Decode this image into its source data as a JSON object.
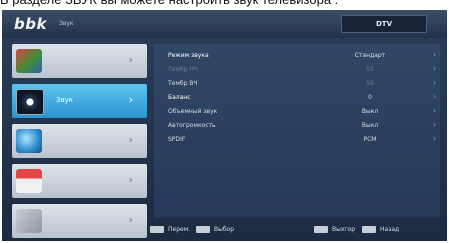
{
  "caption": "В разделе ЗВУК вы можете настроить звук телевизора :",
  "header": {
    "logo": "bbk",
    "section": "Звук",
    "source": "DTV"
  },
  "sidebar": {
    "items": [
      {
        "label": "",
        "icon": "picture-icon",
        "active": false
      },
      {
        "label": "Звук",
        "icon": "speaker-icon",
        "active": true
      },
      {
        "label": "",
        "icon": "globe-icon",
        "active": false
      },
      {
        "label": "",
        "icon": "tv-icon",
        "active": false
      },
      {
        "label": "",
        "icon": "settings-icon",
        "active": false
      }
    ]
  },
  "sound_menu": {
    "rows": [
      {
        "label": "Режим звука",
        "value": "Стандарт"
      },
      {
        "label": "Тембр НЧ",
        "value": "50"
      },
      {
        "label": "Тембр ВЧ",
        "value": "50"
      },
      {
        "label": "Баланс",
        "value": "0"
      },
      {
        "label": "Объемный звук",
        "value": "Выкл"
      },
      {
        "label": "Автогромкость",
        "value": "Выкл"
      },
      {
        "label": "SPDIF",
        "value": "PCM"
      }
    ]
  },
  "footer": {
    "hint_move": "Перем.",
    "hint_select": "Выбор",
    "hint_exit": "Выхгор",
    "hint_back": "Назад"
  },
  "colors": {
    "active_tab": "#2b94cf",
    "panel_bg": "#26395a",
    "screen_bg": "#1d2b42"
  }
}
